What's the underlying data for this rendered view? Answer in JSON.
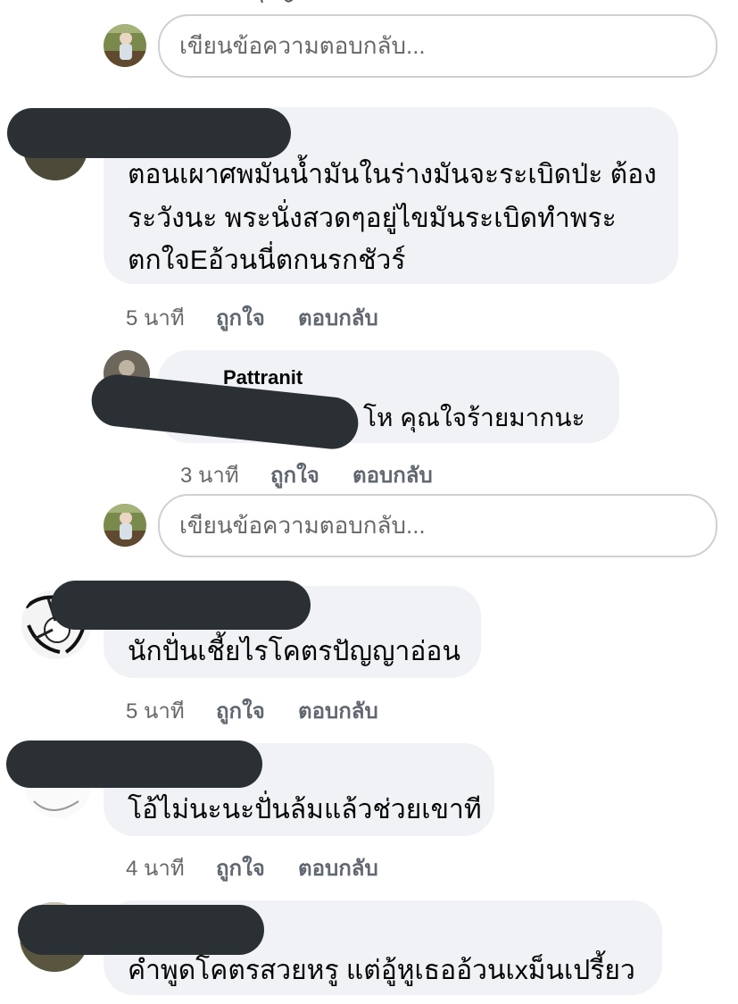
{
  "colors": {
    "bubble": "#f0f2f5",
    "redaction": "#2b3034",
    "meta_text": "#65676b",
    "link": "#1877f2"
  },
  "reply_box": {
    "placeholder": "เขียนข้อความตอบกลับ..."
  },
  "actions": {
    "like": "ถูกใจ",
    "reply": "ตอบกลับ"
  },
  "comments": [
    {
      "lines": [
        "ตอนเผาศพมันน้ำมันในร่างมันจะระเบิดป่ะ ต้อง",
        "ระวังนะ พระนั่งสวดๆอยู่ไขมันระเบิดทำพระ",
        "ตกใจEอ้วนนี่ตกนรกชัวร์"
      ],
      "time": "5 นาที"
    },
    {
      "author_partial": "Pattranit",
      "text": "โห คุณใจร้ายมากนะ",
      "time": "3 นาที"
    },
    {
      "text": "นักปั่นเชี้ยไรโคตรปัญญาอ่อน",
      "time": "5 นาที"
    },
    {
      "text": "โอ้ไม่นะนะปั่นล้มแล้วช่วยเขาที",
      "time": "4 นาที"
    },
    {
      "text": "คำพูดโคตรสวยหรู แต่อู้หูเธออ้วนเxม็นเปรี้ยว"
    }
  ]
}
